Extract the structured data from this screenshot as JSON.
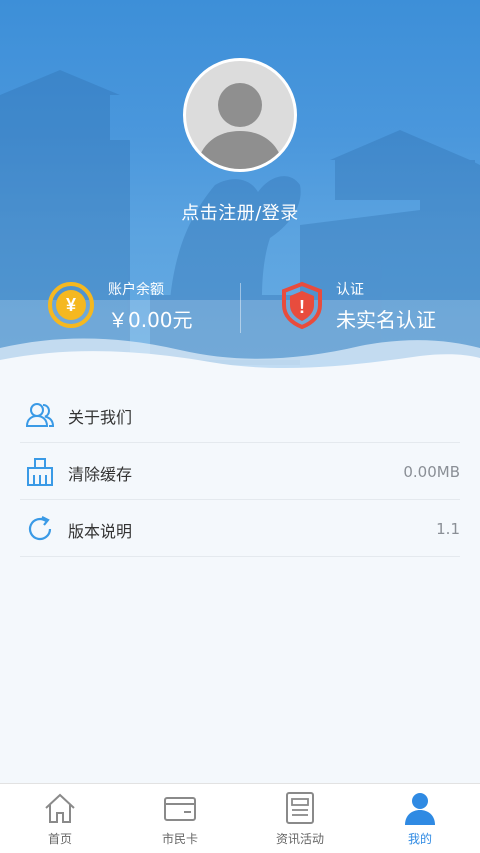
{
  "profile": {
    "login_prompt": "点击注册/登录"
  },
  "account": {
    "balance_label": "账户余额",
    "balance_value": "￥0.00元",
    "balance_icon_symbol": "¥",
    "verify_label": "认证",
    "verify_value": "未实名认证",
    "verify_icon_symbol": "!"
  },
  "menu": {
    "items": [
      {
        "label": "关于我们",
        "value": "",
        "icon": "users-icon"
      },
      {
        "label": "清除缓存",
        "value": "0.00MB",
        "icon": "broom-icon"
      },
      {
        "label": "版本说明",
        "value": "1.1",
        "icon": "refresh-icon"
      }
    ]
  },
  "tabbar": {
    "tabs": [
      {
        "label": "首页",
        "icon": "home-icon"
      },
      {
        "label": "市民卡",
        "icon": "wallet-icon"
      },
      {
        "label": "资讯活动",
        "icon": "news-icon"
      },
      {
        "label": "我的",
        "icon": "person-icon"
      }
    ],
    "active_index": 3
  },
  "colors": {
    "header_blue": "#4a97dc",
    "accent_blue": "#2f8ae3",
    "coin_yellow": "#f5b820",
    "shield_red": "#e84c3d"
  }
}
